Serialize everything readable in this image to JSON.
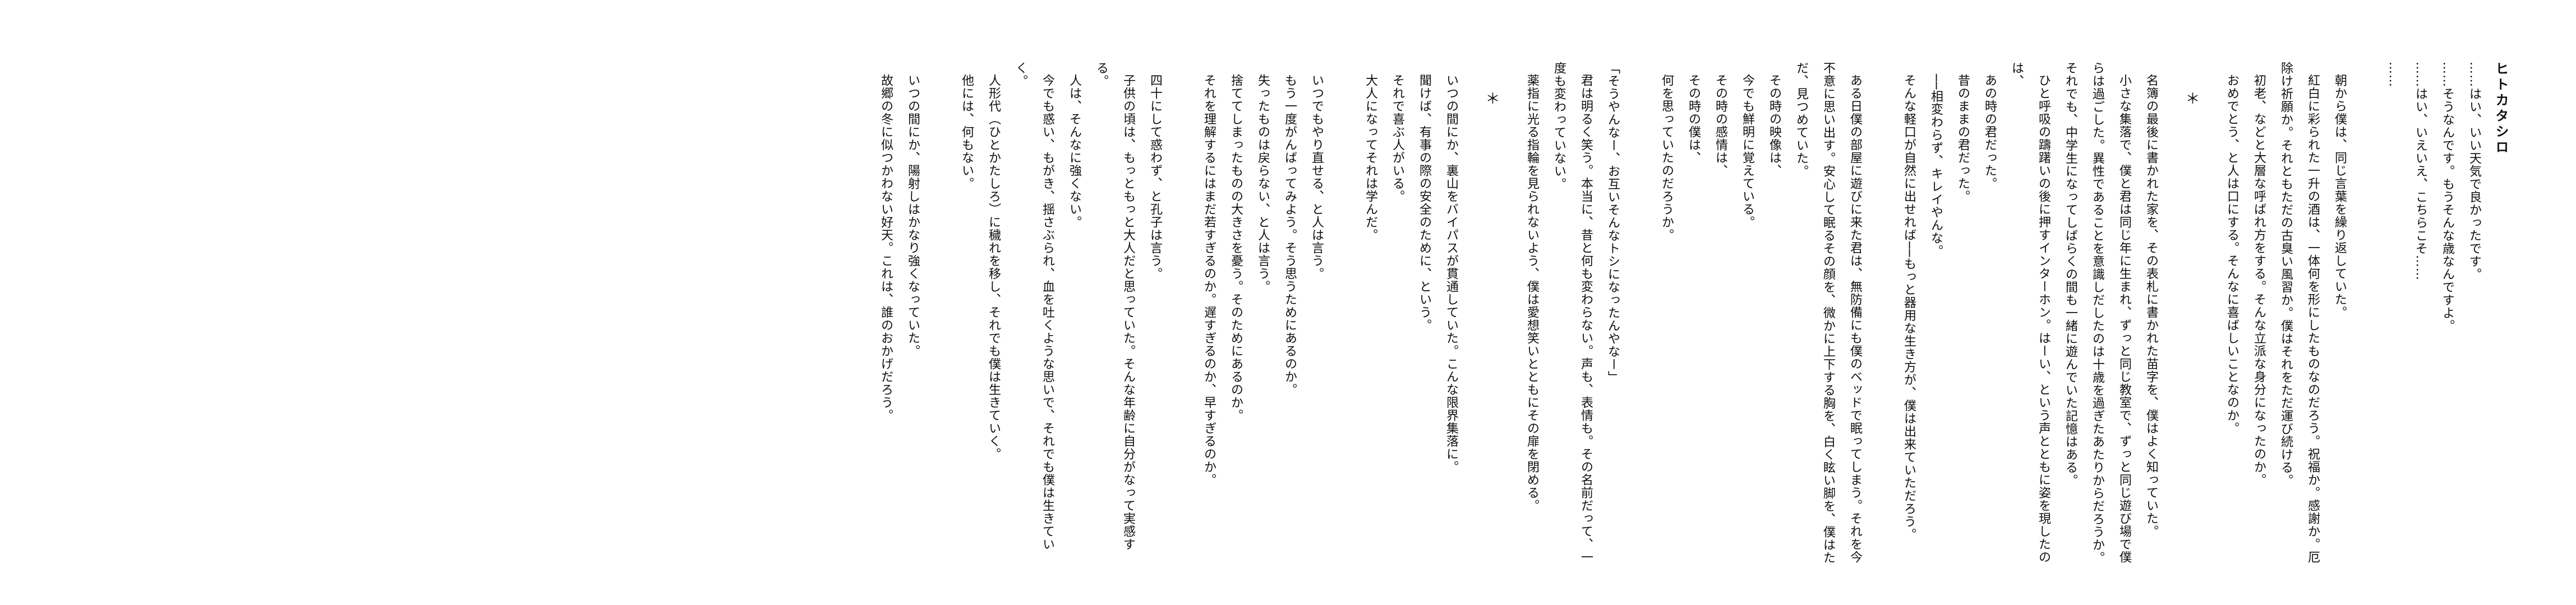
{
  "title": "ヒトカタシロ",
  "body": [
    "……はい、いい天気で良かったです。",
    "……そうなんです。もうそんな歳なんですよ。",
    "……はい、いえいえ、こちらこそ……",
    "……",
    "",
    "朝から僕は、同じ言葉を繰り返していた。",
    "紅白に彩られた一升の酒は、一体何を形にしたものなのだろう。祝福か。感謝か。厄除け祈願か。それともただの古臭い風習か。僕はそれをただ運び続ける。",
    "初老、などと大層な呼ばれ方をする。そんな立派な身分になったのか。",
    "おめでとう、と人は口にする。そんなに喜ばしいことなのか。",
    "＊",
    "名簿の最後に書かれた家を、その表札に書かれた苗字を、僕はよく知っていた。",
    "小さな集落で、僕と君は同じ年に生まれ、ずっと同じ教室で、ずっと同じ遊び場で僕らは過ごした。異性であることを意識しだしたのは十歳を過ぎたあたりからだろうか。それでも、中学生になってしばらくの間も一緒に遊んでいた記憶はある。",
    "ひと呼吸の躊躇いの後に押すインターホン。はーい、という声とともに姿を現したのは、",
    "あの時の君だった。",
    "昔のままの君だった。",
    "──相変わらず、キレイやんな。",
    "そんな軽口が自然に出せれば──もっと器用な生き方が、僕は出来ていただろう。",
    "",
    "ある日僕の部屋に遊びに来た君は、無防備にも僕のベッドで眠ってしまう。それを今不意に思い出す。安心して眠るその顔を、微かに上下する胸を、白く眩い脚を、僕はただ、見つめていた。",
    "その時の映像は、",
    "今でも鮮明に覚えている。",
    "その時の感情は、",
    "その時の僕は、",
    "何を思っていたのだろうか。",
    "",
    "「そうやんなー、お互いそんなトシになったんやなー」",
    "君は明るく笑う。本当に、昔と何も変わらない。声も、表情も。その名前だって、一度も変わっていない。",
    "薬指に光る指輪を見られないよう、僕は愛想笑いとともにその扉を閉める。",
    "＊",
    "いつの間にか、裏山をバイパスが貫通していた。こんな限界集落に。",
    "聞けば、有事の際の安全のために、という。",
    "それで喜ぶ人がいる。",
    "大人になってそれは学んだ。",
    "",
    "いつでもやり直せる、と人は言う。",
    "もう一度がんばってみよう。そう思うためにあるのか。",
    "失ったものは戻らない、と人は言う。",
    "捨ててしまったものの大きさを憂う。そのためにあるのか。",
    "それを理解するにはまだ若すぎるのか。遅すぎるのか、早すぎるのか。",
    "",
    "四十にして惑わず、と孔子は言う。",
    "子供の頃は、もっともっと大人だと思っていた。そんな年齢に自分がなって実感する。",
    "人は、そんなに強くない。",
    "今でも惑い、もがき、揺さぶられ、血を吐くような思いで、それでも僕は生きていく。",
    "人形代（ひとかたしろ）に穢れを移し、それでも僕は生きていく。",
    "他には、何もない。",
    "",
    "いつの間にか、陽射しはかなり強くなっていた。",
    "故郷の冬に似つかわない好天。これは、誰のおかげだろう。"
  ]
}
